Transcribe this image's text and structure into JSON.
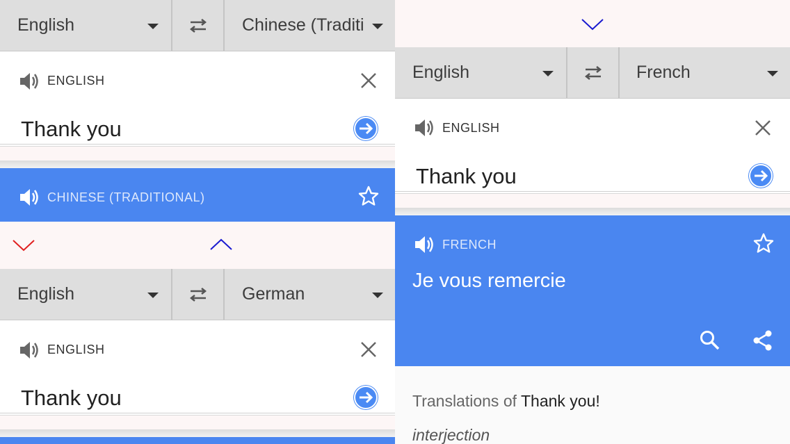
{
  "left": {
    "top_bar": {
      "source_lang": "English",
      "target_lang": "Chinese (Traditional)"
    },
    "input_card": {
      "source_label": "ENGLISH",
      "input_text": "Thank you"
    },
    "result": {
      "target_label": "CHINESE (TRADITIONAL)"
    },
    "second_bar": {
      "source_lang": "English",
      "target_lang": "German"
    },
    "second_card": {
      "source_label": "ENGLISH",
      "input_text": "Thank you"
    }
  },
  "right": {
    "bar": {
      "source_lang": "English",
      "target_lang": "French"
    },
    "input_card": {
      "source_label": "ENGLISH",
      "input_text": "Thank you"
    },
    "result": {
      "target_label": "FRENCH",
      "translation": "Je vous remercie"
    },
    "translations_of": {
      "prefix": "Translations of",
      "phrase": "Thank you!",
      "part_of_speech": "interjection"
    }
  },
  "colors": {
    "accent_blue": "#4a86f0",
    "down_arrow_red": "#e02020",
    "arrow_blue": "#1a1ad0"
  },
  "icons": [
    "speaker-icon",
    "swap-icon",
    "dropdown-caret-icon",
    "close-icon",
    "go-arrow-icon",
    "star-icon",
    "search-icon",
    "share-icon",
    "chevron-down-icon",
    "chevron-up-icon"
  ]
}
